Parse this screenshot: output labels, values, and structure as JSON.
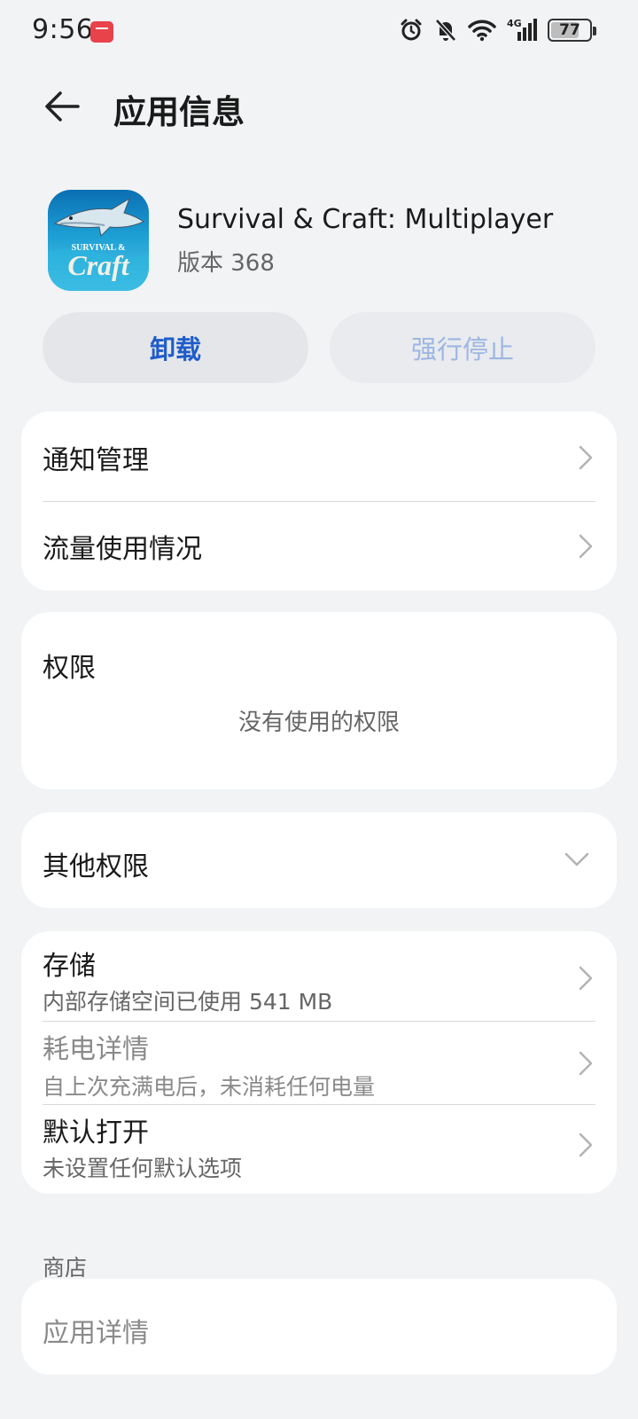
{
  "status_bar": {
    "time": "9:56",
    "battery": "77",
    "battery_level_percent": 77,
    "network_label": "4G",
    "icons": [
      "alarm-icon",
      "mute-bell-icon",
      "wifi-icon",
      "signal-4g-icon",
      "battery-icon"
    ]
  },
  "header": {
    "title": "应用信息",
    "back_icon": "back-arrow-icon"
  },
  "app": {
    "name": "Survival & Craft: Multiplayer",
    "version": "版本 368",
    "icon_lettering": "SURVIVAL & Craft"
  },
  "actions": {
    "uninstall": "卸载",
    "force_stop": "强行停止"
  },
  "card1": {
    "notification": "通知管理",
    "data_usage": "流量使用情况"
  },
  "permissions": {
    "title": "权限",
    "empty": "没有使用的权限"
  },
  "other_permissions": {
    "title": "其他权限"
  },
  "storage_card": {
    "storage_title": "存储",
    "storage_sub": "内部存储空间已使用 541 MB",
    "power_title": "耗电详情",
    "power_sub": "自上次充满电后，未消耗任何电量",
    "default_title": "默认打开",
    "default_sub": "未设置任何默认选项"
  },
  "store": {
    "caption": "商店",
    "app_details": "应用详情"
  },
  "colors": {
    "background": "#f1f3f5",
    "accent": "#1f5cc9",
    "disabled_accent": "#9db6e3"
  }
}
